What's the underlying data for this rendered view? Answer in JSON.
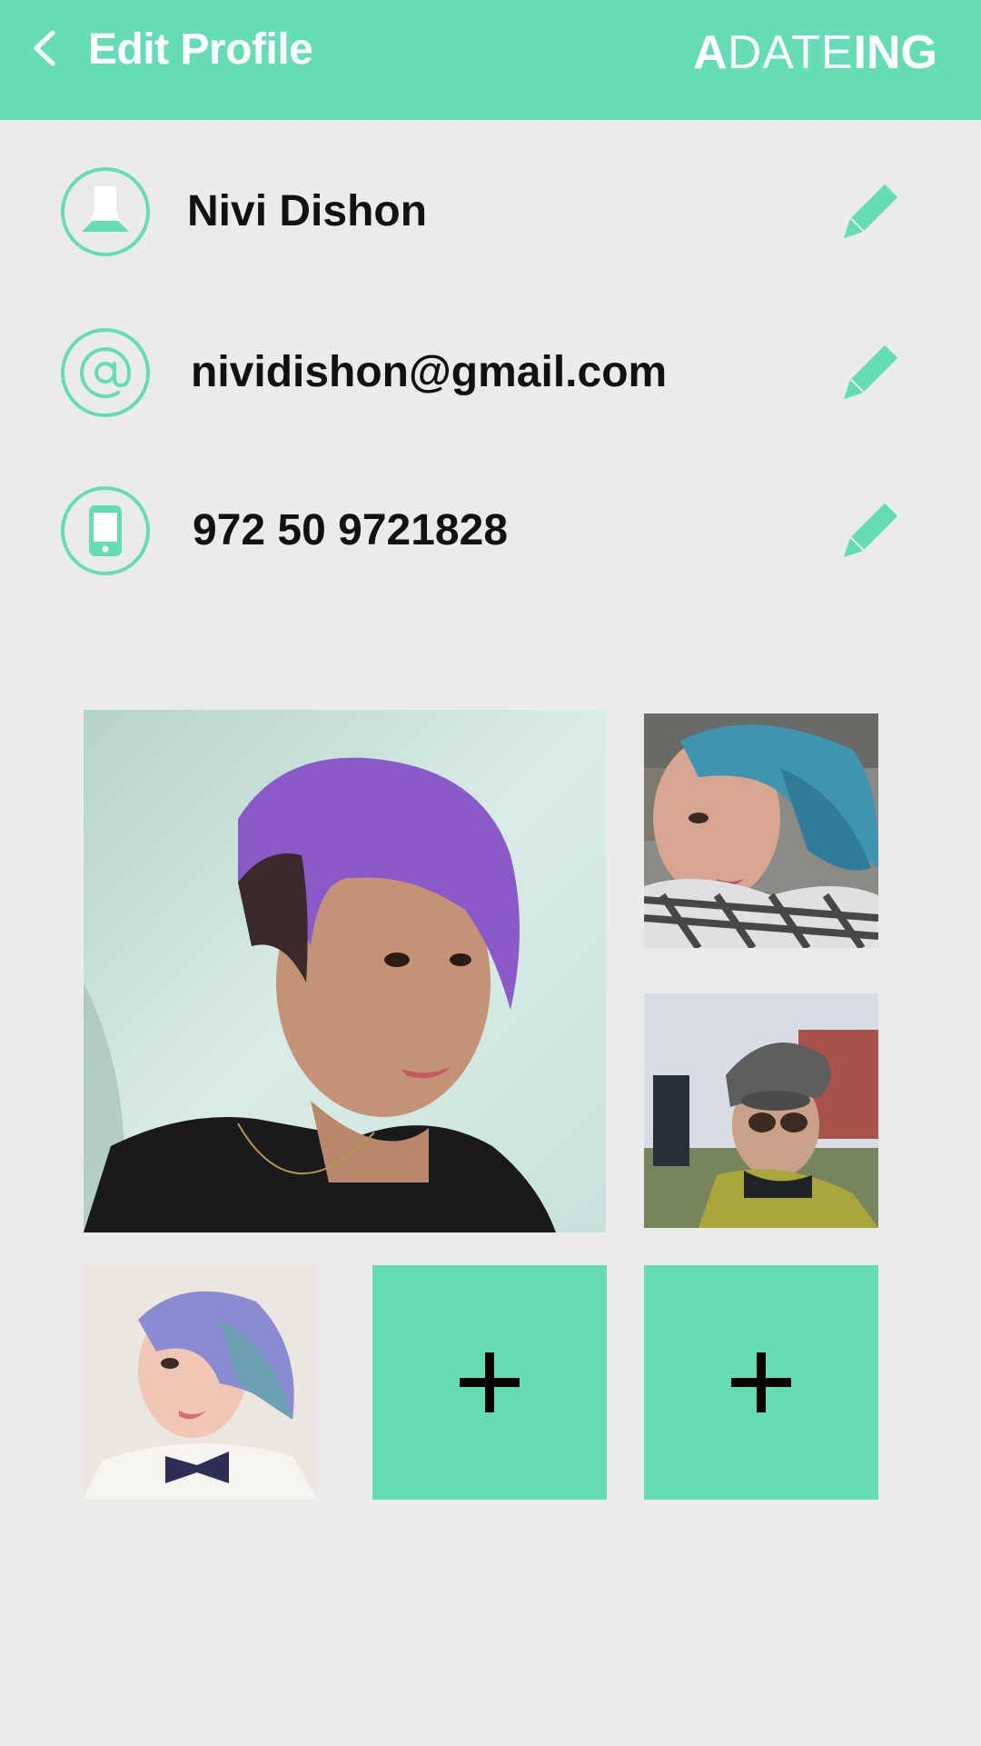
{
  "header": {
    "title": "Edit Profile",
    "back_icon": "chevron-left-icon",
    "brand": {
      "part1": "A",
      "part2": "DATE",
      "part3": "ING"
    },
    "background_color": "#64dcb6"
  },
  "profile": {
    "name": "Nivi Dishon",
    "email": "nividishon@gmail.com",
    "phone": "972 50 9721828",
    "icons": {
      "name": "person-icon",
      "email": "at-sign-icon",
      "phone": "mobile-phone-icon",
      "edit": "pencil-icon"
    }
  },
  "photos": {
    "slots": [
      {
        "kind": "photo",
        "subject": "purple hair portrait"
      },
      {
        "kind": "photo",
        "subject": "blue hair with scarf"
      },
      {
        "kind": "photo",
        "subject": "beanie and sunglasses"
      },
      {
        "kind": "photo",
        "subject": "bow tie portrait"
      },
      {
        "kind": "add",
        "icon": "plus-icon"
      },
      {
        "kind": "add",
        "icon": "plus-icon"
      }
    ]
  },
  "colors": {
    "accent": "#64dcb6",
    "background": "#ebebeb",
    "text": "#111111"
  }
}
